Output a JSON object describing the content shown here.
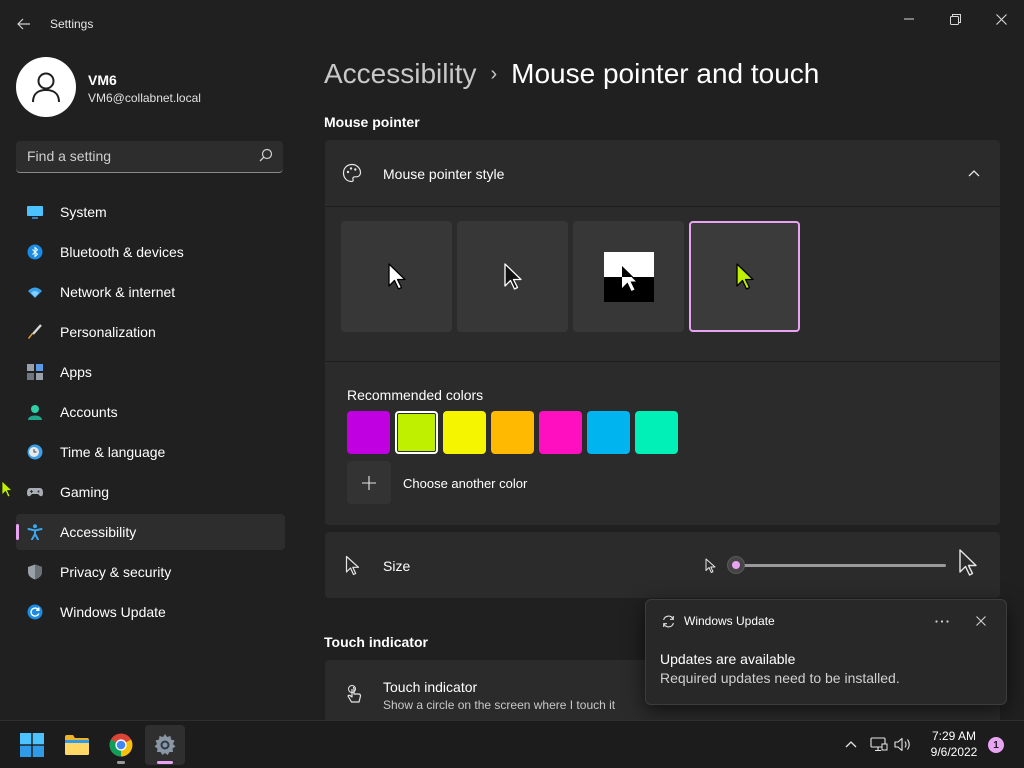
{
  "window": {
    "title": "Settings",
    "back_icon": "back-arrow-icon",
    "controls": [
      "minimize-icon",
      "restore-icon",
      "close-icon"
    ]
  },
  "profile": {
    "name": "VM6",
    "email": "VM6@collabnet.local",
    "avatar_icon": "person-icon"
  },
  "search": {
    "placeholder": "Find a setting",
    "icon": "search-icon"
  },
  "sidebar": {
    "items": [
      {
        "label": "System",
        "icon": "system-icon",
        "selected": false
      },
      {
        "label": "Bluetooth & devices",
        "icon": "bluetooth-icon",
        "selected": false
      },
      {
        "label": "Network & internet",
        "icon": "network-icon",
        "selected": false
      },
      {
        "label": "Personalization",
        "icon": "personalization-icon",
        "selected": false
      },
      {
        "label": "Apps",
        "icon": "apps-icon",
        "selected": false
      },
      {
        "label": "Accounts",
        "icon": "accounts-icon",
        "selected": false
      },
      {
        "label": "Time & language",
        "icon": "time-language-icon",
        "selected": false
      },
      {
        "label": "Gaming",
        "icon": "gaming-icon",
        "selected": false
      },
      {
        "label": "Accessibility",
        "icon": "accessibility-icon",
        "selected": true
      },
      {
        "label": "Privacy & security",
        "icon": "privacy-shield-icon",
        "selected": false
      },
      {
        "label": "Windows Update",
        "icon": "windows-update-icon",
        "selected": false
      }
    ]
  },
  "main": {
    "breadcrumb": {
      "parent": "Accessibility",
      "separator": "›",
      "current": "Mouse pointer and touch"
    },
    "mouse_pointer_section": {
      "heading": "Mouse pointer",
      "style_card": {
        "label": "Mouse pointer style",
        "styles": [
          {
            "name": "white",
            "selected": false
          },
          {
            "name": "black",
            "selected": false
          },
          {
            "name": "inverted",
            "selected": false
          },
          {
            "name": "custom",
            "selected": true
          }
        ]
      },
      "recommended_colors": {
        "label": "Recommended colors",
        "colors": [
          "#C000E0",
          "#BFF000",
          "#F6F500",
          "#FFB900",
          "#FF0FC0",
          "#00B4F0",
          "#00F0B8"
        ],
        "selected_index": 1,
        "choose_label": "Choose another color"
      },
      "size": {
        "label": "Size",
        "value_fraction": 0.0
      }
    },
    "touch_section": {
      "heading": "Touch indicator",
      "item_label": "Touch indicator",
      "item_description": "Show a circle on the screen where I touch it"
    }
  },
  "toast": {
    "app": "Windows Update",
    "more_icon": "more-options-icon",
    "title": "Updates are available",
    "body": "Required updates need to be installed."
  },
  "taskbar": {
    "apps": [
      "start-icon",
      "file-explorer-icon",
      "chrome-icon",
      "settings-icon"
    ],
    "time": "7:29 AM",
    "date": "9/6/2022",
    "notification_count": "1"
  },
  "colors": {
    "accent": "#E8A4F2",
    "background": "#202020",
    "card": "#2B2B2B",
    "pointer_color": "#BFF000"
  }
}
